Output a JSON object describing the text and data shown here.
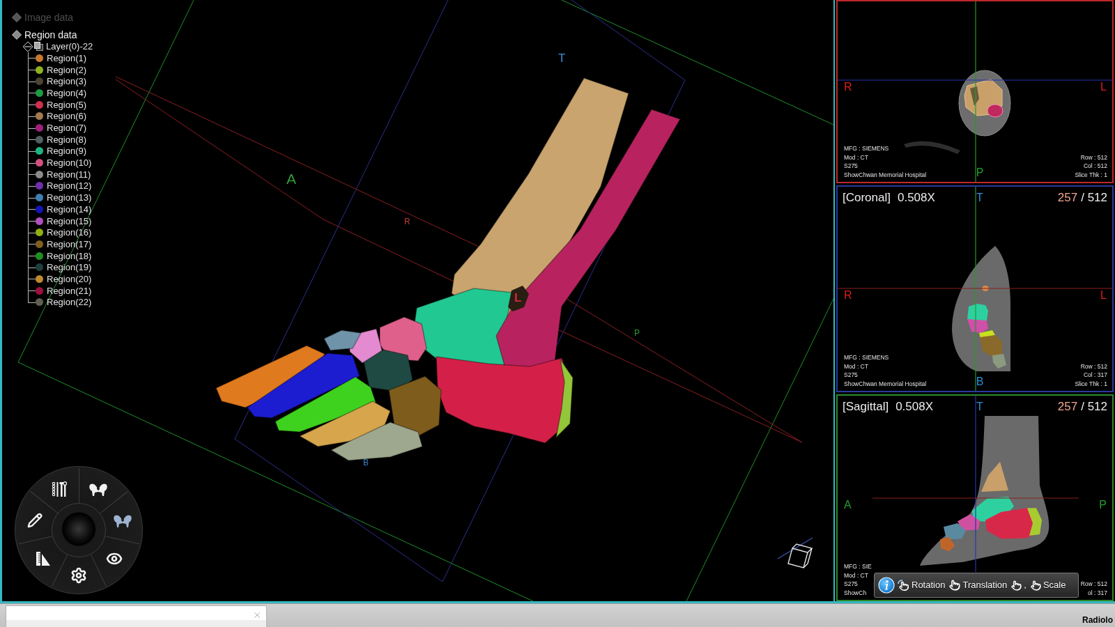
{
  "tree": {
    "roots": [
      {
        "label": "Image data",
        "disabled": true
      },
      {
        "label": "Region data",
        "disabled": false,
        "children": [
          {
            "label": "Layer(0)-22",
            "expanded": true,
            "children": [
              {
                "label": "Region(1)",
                "color": "#c8772e"
              },
              {
                "label": "Region(2)",
                "color": "#8fb21e"
              },
              {
                "label": "Region(3)",
                "color": "#4d4330"
              },
              {
                "label": "Region(4)",
                "color": "#1f9a44"
              },
              {
                "label": "Region(5)",
                "color": "#d02f4e"
              },
              {
                "label": "Region(6)",
                "color": "#a27a4e"
              },
              {
                "label": "Region(7)",
                "color": "#a01f7c"
              },
              {
                "label": "Region(8)",
                "color": "#4f5f62"
              },
              {
                "label": "Region(9)",
                "color": "#1fb384"
              },
              {
                "label": "Region(10)",
                "color": "#d2507f"
              },
              {
                "label": "Region(11)",
                "color": "#8a8a8a"
              },
              {
                "label": "Region(12)",
                "color": "#6f2fae"
              },
              {
                "label": "Region(13)",
                "color": "#3f7fb2"
              },
              {
                "label": "Region(14)",
                "color": "#1414b8"
              },
              {
                "label": "Region(15)",
                "color": "#b04fc0"
              },
              {
                "label": "Region(16)",
                "color": "#8fb010"
              },
              {
                "label": "Region(17)",
                "color": "#7f5f20"
              },
              {
                "label": "Region(18)",
                "color": "#1f8f1f"
              },
              {
                "label": "Region(19)",
                "color": "#1f3f3f"
              },
              {
                "label": "Region(20)",
                "color": "#c08a2f"
              },
              {
                "label": "Region(21)",
                "color": "#a0103f"
              },
              {
                "label": "Region(22)",
                "color": "#5f5f4f"
              }
            ]
          }
        ]
      }
    ]
  },
  "viewport": {
    "axis_labels": [
      {
        "text": "T",
        "kind": "superior",
        "color": "#3b8fd6"
      },
      {
        "text": "A",
        "kind": "anterior",
        "color": "#2f9a33"
      },
      {
        "text": "R",
        "kind": "right",
        "color": "#c43a3a"
      },
      {
        "text": "L",
        "kind": "left",
        "color": "#d02a3a"
      },
      {
        "text": "P",
        "kind": "posterior",
        "color": "#2f9a33"
      },
      {
        "text": "B",
        "kind": "inferior",
        "color": "#3b7fc0"
      }
    ]
  },
  "radial_menu": {
    "items": [
      {
        "kind": "implant",
        "selected": false
      },
      {
        "kind": "pelvis",
        "selected": false
      },
      {
        "kind": "pelvis",
        "selected": true
      },
      {
        "kind": "view",
        "selected": false
      },
      {
        "kind": "settings",
        "selected": false
      },
      {
        "kind": "measure",
        "selected": false
      },
      {
        "kind": "draw",
        "selected": false
      }
    ]
  },
  "views": [
    {
      "kind": "axial",
      "color": "#c0282c",
      "labels": [
        {
          "text": "R",
          "kind": "left",
          "color": "#e01b1b"
        },
        {
          "text": "L",
          "kind": "right",
          "color": "#e01b1b"
        },
        {
          "text": "P",
          "kind": "bottom",
          "color": "#23a12c"
        }
      ],
      "info_left": [
        "MFG : SIEMENS",
        "Mod : CT",
        "S275",
        "ShowChwan Memorial Hospital"
      ],
      "info_right": [
        "Row : 512",
        "Col : 512",
        "Slice Thk : 1"
      ]
    },
    {
      "kind": "coronal",
      "color": "#2a3aa0",
      "title": "[Coronal]",
      "zoom": "0.508X",
      "slice": "257",
      "slice_total": "/ 512",
      "labels": [
        {
          "text": "T",
          "kind": "top",
          "color": "#2b8fdc"
        },
        {
          "text": "R",
          "kind": "left",
          "color": "#e01b1b"
        },
        {
          "text": "L",
          "kind": "right",
          "color": "#e01b1b"
        },
        {
          "text": "B",
          "kind": "bottom",
          "color": "#2b8fdc"
        }
      ],
      "info_left": [
        "MFG : SIEMENS",
        "Mod : CT",
        "S275",
        "ShowChwan Memorial Hospital"
      ],
      "info_right": [
        "Row : 512",
        "Col : 317",
        "Slice Thk : 1"
      ]
    },
    {
      "kind": "sagittal",
      "color": "#2c8a2c",
      "title": "[Sagittal]",
      "zoom": "0.508X",
      "slice": "257",
      "slice_total": "/ 512",
      "labels": [
        {
          "text": "T",
          "kind": "top",
          "color": "#2b8fdc"
        },
        {
          "text": "A",
          "kind": "left",
          "color": "#23a12c"
        },
        {
          "text": "P",
          "kind": "right",
          "color": "#23a12c"
        }
      ],
      "info_left": [
        "MFG : SIE",
        "Mod : CT",
        "S275",
        "ShowCh"
      ],
      "info_right": [
        "Row : 512",
        "ol : 317"
      ],
      "gesture_bar": {
        "items": [
          {
            "kind": "rotate",
            "label": "Rotation"
          },
          {
            "kind": "pan",
            "label": "Translation"
          },
          {
            "kind": "pinch",
            "label": "Scale",
            "joiner": ","
          }
        ]
      }
    }
  ],
  "bottom_bar": {
    "status_text": "Radiolo"
  }
}
